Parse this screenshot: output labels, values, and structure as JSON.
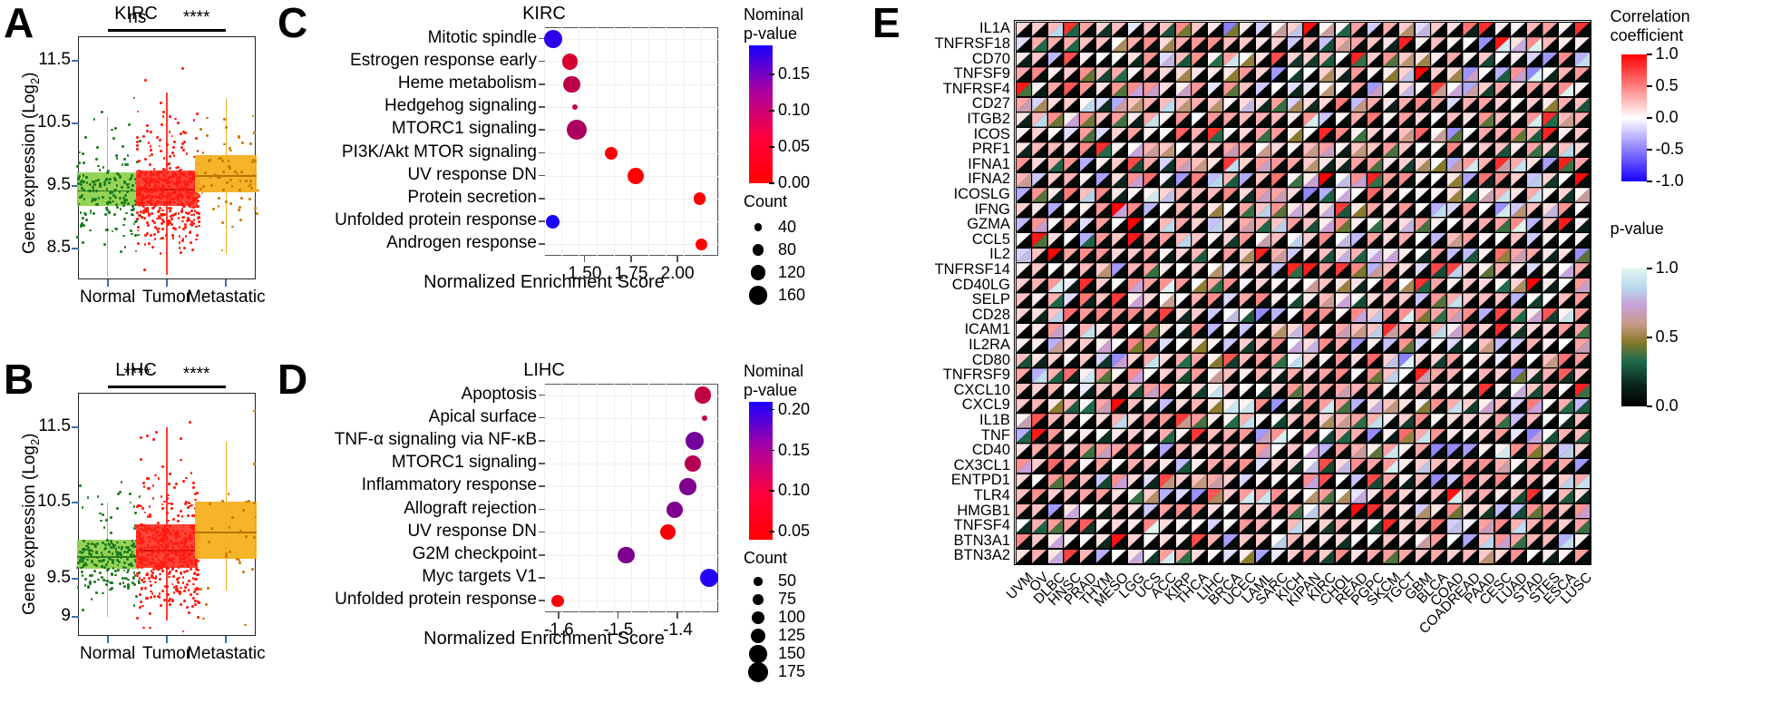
{
  "figure": {
    "panels": [
      "A",
      "B",
      "C",
      "D",
      "E"
    ]
  },
  "panelA": {
    "letter": "A",
    "title": "KIRC",
    "ylabel_pre": "Gene expression (Log",
    "ylabel_sub": "2",
    "ylabel_post": ")",
    "yticks": [
      "11.5",
      "10.5",
      "9.5",
      "8.5"
    ],
    "xticks": [
      "Normal",
      "Tumor",
      "Metastatic"
    ],
    "significance": [
      "ns",
      "****"
    ],
    "colors": {
      "normal": "#8fd14f",
      "normal_dark": "#1d7a1d",
      "tumor": "#ff3b30",
      "tumor_dark": "#e01b10",
      "metastatic": "#f5b01e",
      "metastatic_dark": "#cc7a00"
    }
  },
  "panelB": {
    "letter": "B",
    "title": "LIHC",
    "ylabel_pre": "Gene expression (Log",
    "ylabel_sub": "2",
    "ylabel_post": ")",
    "yticks": [
      "11.5",
      "10.5",
      "9.5",
      "9"
    ],
    "xticks": [
      "Normal",
      "Tumor",
      "Metastatic"
    ],
    "significance": [
      "****",
      "****"
    ]
  },
  "panelC": {
    "letter": "C",
    "title": "KIRC",
    "xlabel": "Normalized Enrichment Score",
    "xticks": [
      "1.50",
      "1.75",
      "2.00"
    ],
    "legend_color_title_line1": "Nominal",
    "legend_color_title_line2": "p-value",
    "legend_color_ticks": [
      "0.15",
      "0.10",
      "0.05",
      "0.00"
    ],
    "legend_size_title": "Count",
    "legend_size_values": [
      "40",
      "80",
      "120",
      "160"
    ],
    "pathways": [
      {
        "label": "Mitotic spindle",
        "nes": 1.33,
        "pvalue": 0.175,
        "count": 150
      },
      {
        "label": "Estrogen response early",
        "nes": 1.42,
        "pvalue": 0.035,
        "count": 130
      },
      {
        "label": "Heme metabolism",
        "nes": 1.43,
        "pvalue": 0.055,
        "count": 140
      },
      {
        "label": "Hedgehog signaling",
        "nes": 1.445,
        "pvalue": 0.045,
        "count": 20
      },
      {
        "label": "MTORC1 signaling",
        "nes": 1.455,
        "pvalue": 0.07,
        "count": 170
      },
      {
        "label": "PI3K/Akt MTOR signaling",
        "nes": 1.64,
        "pvalue": 0.005,
        "count": 95
      },
      {
        "label": "UV response DN",
        "nes": 1.775,
        "pvalue": 0.0,
        "count": 130
      },
      {
        "label": "Protein secretion",
        "nes": 2.12,
        "pvalue": 0.0,
        "count": 90
      },
      {
        "label": "Unfolded protein response",
        "nes": 1.325,
        "pvalue": 0.19,
        "count": 105
      },
      {
        "label": "Androgen response",
        "nes": 2.13,
        "pvalue": 0.0,
        "count": 90
      }
    ]
  },
  "panelD": {
    "letter": "D",
    "title": "LIHC",
    "xlabel": "Normalized Enrichment Score",
    "xticks": [
      "-1.6",
      "-1.5",
      "-1.4"
    ],
    "legend_color_title_line1": "Nominal",
    "legend_color_title_line2": "p-value",
    "legend_color_ticks": [
      "0.20",
      "0.15",
      "0.10",
      "0.05"
    ],
    "legend_size_title": "Count",
    "legend_size_values": [
      "50",
      "75",
      "100",
      "125",
      "150",
      "175"
    ],
    "pathways": [
      {
        "label": "Apoptosis",
        "nes": -1.358,
        "pvalue": 0.085,
        "count": 140
      },
      {
        "label": "Apical surface",
        "nes": -1.355,
        "pvalue": 0.09,
        "count": 20
      },
      {
        "label": "TNF-α signaling via NF-κB",
        "nes": -1.372,
        "pvalue": 0.145,
        "count": 155
      },
      {
        "label": "MTORC1 signaling",
        "nes": -1.375,
        "pvalue": 0.095,
        "count": 140
      },
      {
        "label": "Inflammatory response",
        "nes": -1.383,
        "pvalue": 0.135,
        "count": 140
      },
      {
        "label": "Allograft rejection",
        "nes": -1.405,
        "pvalue": 0.135,
        "count": 135
      },
      {
        "label": "UV response DN",
        "nes": -1.417,
        "pvalue": 0.045,
        "count": 130
      },
      {
        "label": "G2M checkpoint",
        "nes": -1.487,
        "pvalue": 0.135,
        "count": 140
      },
      {
        "label": "Myc targets V1",
        "nes": -1.347,
        "pvalue": 0.205,
        "count": 160
      },
      {
        "label": "Unfolded protein response",
        "nes": -1.602,
        "pvalue": 0.045,
        "count": 90
      }
    ]
  },
  "panelE": {
    "letter": "E",
    "legend_corr_title_line1": "Correlation",
    "legend_corr_title_line2": "coefficient",
    "legend_corr_ticks": [
      "1.0",
      "0.5",
      "0.0",
      "-0.5",
      "-1.0"
    ],
    "legend_p_title": "p-value",
    "legend_p_ticks": [
      "1.0",
      "0.5",
      "0.0"
    ],
    "genes": [
      "IL1A",
      "TNFRSF18",
      "CD70",
      "TNFSF9",
      "TNFRSF4",
      "CD27",
      "ITGB2",
      "ICOS",
      "PRF1",
      "IFNA1",
      "IFNA2",
      "ICOSLG",
      "IFNG",
      "GZMA",
      "CCL5",
      "IL2",
      "TNFRSF14",
      "CD40LG",
      "SELP",
      "CD28",
      "ICAM1",
      "IL2RA",
      "CD80",
      "TNFRSF9",
      "CXCL10",
      "CXCL9",
      "IL1B",
      "TNF",
      "CD40",
      "CX3CL1",
      "ENTPD1",
      "TLR4",
      "HMGB1",
      "TNFSF4",
      "BTN3A1",
      "BTN3A2"
    ],
    "cancers": [
      "UVM",
      "OV",
      "DLBC",
      "HNSC",
      "PRAD",
      "THYM",
      "MESO",
      "LGG",
      "UCS",
      "ACC",
      "KIRP",
      "THCA",
      "LIHC",
      "BRCA",
      "UCEC",
      "LAML",
      "SARC",
      "KICH",
      "KIPAN",
      "KIRC",
      "CHOL",
      "READ",
      "PGPC",
      "SKCM",
      "TGCT",
      "GBM",
      "BLCA",
      "COAD",
      "COADREAD",
      "PAAD",
      "CESC",
      "LUAD",
      "STAD",
      "STES",
      "ESCA",
      "LUSC"
    ]
  },
  "chart_data": [
    {
      "type": "box",
      "title": "KIRC",
      "xlabel": "",
      "ylabel": "Gene expression (Log2)",
      "categories": [
        "Normal",
        "Tumor",
        "Metastatic"
      ],
      "ylim": [
        8.0,
        11.9
      ],
      "yticks": [
        11.5,
        10.5,
        9.5,
        8.5
      ],
      "boxes": [
        {
          "name": "Normal",
          "q1": 9.18,
          "median": 9.43,
          "q3": 9.72,
          "whisker_low": 8.05,
          "whisker_high": 10.6,
          "color": "#8fd14f",
          "n": 190
        },
        {
          "name": "Tumor",
          "q1": 9.18,
          "median": 9.45,
          "q3": 9.75,
          "whisker_low": 8.08,
          "whisker_high": 11.0,
          "color": "#ff3b30",
          "n": 520
        },
        {
          "name": "Metastatic",
          "q1": 9.4,
          "median": 9.67,
          "q3": 10.0,
          "whisker_low": 8.4,
          "whisker_high": 10.9,
          "color": "#f5b01e",
          "n": 70
        }
      ],
      "annotations": [
        {
          "text": "ns",
          "between": [
            "Normal",
            "Tumor"
          ]
        },
        {
          "text": "****",
          "between": [
            "Tumor",
            "Metastatic"
          ]
        }
      ],
      "grid": false
    },
    {
      "type": "box",
      "title": "LIHC",
      "xlabel": "",
      "ylabel": "Gene expression (Log2)",
      "categories": [
        "Normal",
        "Tumor",
        "Metastatic"
      ],
      "ylim": [
        8.75,
        11.95
      ],
      "yticks": [
        11.5,
        10.5,
        9.5,
        9.0
      ],
      "boxes": [
        {
          "name": "Normal",
          "q1": 9.63,
          "median": 9.8,
          "q3": 10.02,
          "whisker_low": 9.0,
          "whisker_high": 10.5,
          "color": "#8fd14f",
          "n": 220
        },
        {
          "name": "Tumor",
          "q1": 9.65,
          "median": 9.88,
          "q3": 10.22,
          "whisker_low": 8.95,
          "whisker_high": 11.5,
          "color": "#ff3b30",
          "n": 520
        },
        {
          "name": "Metastatic",
          "q1": 9.76,
          "median": 10.12,
          "q3": 10.52,
          "whisker_low": 9.35,
          "whisker_high": 11.3,
          "color": "#f5b01e",
          "n": 30
        }
      ],
      "annotations": [
        {
          "text": "****",
          "between": [
            "Normal",
            "Tumor"
          ]
        },
        {
          "text": "****",
          "between": [
            "Tumor",
            "Metastatic"
          ]
        }
      ],
      "grid": false
    },
    {
      "type": "scatter",
      "title": "KIRC",
      "xlabel": "Normalized Enrichment Score",
      "ylabel": "",
      "xlim": [
        1.28,
        2.22
      ],
      "xticks": [
        1.5,
        1.75,
        2.0
      ],
      "legend_color": {
        "title": "Nominal p-value",
        "ticks": [
          0.15,
          0.1,
          0.05,
          0.0
        ],
        "low_color": "#ff0000",
        "high_color": "#1a00ff"
      },
      "legend_size": {
        "title": "Count",
        "values": [
          40,
          80,
          120,
          160
        ]
      },
      "points": [
        {
          "y": "Mitotic spindle",
          "x": 1.33,
          "p": 0.175,
          "count": 150
        },
        {
          "y": "Estrogen response early",
          "x": 1.42,
          "p": 0.035,
          "count": 130
        },
        {
          "y": "Heme metabolism",
          "x": 1.43,
          "p": 0.055,
          "count": 140
        },
        {
          "y": "Hedgehog signaling",
          "x": 1.445,
          "p": 0.045,
          "count": 20
        },
        {
          "y": "MTORC1 signaling",
          "x": 1.455,
          "p": 0.07,
          "count": 170
        },
        {
          "y": "PI3K/Akt MTOR signaling",
          "x": 1.64,
          "p": 0.005,
          "count": 95
        },
        {
          "y": "UV response DN",
          "x": 1.775,
          "p": 0.0,
          "count": 130
        },
        {
          "y": "Protein secretion",
          "x": 2.12,
          "p": 0.0,
          "count": 90
        },
        {
          "y": "Unfolded protein response",
          "x": 1.325,
          "p": 0.19,
          "count": 105
        },
        {
          "y": "Androgen response",
          "x": 2.13,
          "p": 0.0,
          "count": 90
        }
      ]
    },
    {
      "type": "scatter",
      "title": "LIHC",
      "xlabel": "Normalized Enrichment Score",
      "ylabel": "",
      "xlim": [
        -1.625,
        -1.332
      ],
      "xticks": [
        -1.6,
        -1.5,
        -1.4
      ],
      "legend_color": {
        "title": "Nominal p-value",
        "ticks": [
          0.2,
          0.15,
          0.1,
          0.05
        ],
        "low_color": "#ff0000",
        "high_color": "#1a00ff"
      },
      "legend_size": {
        "title": "Count",
        "values": [
          50,
          75,
          100,
          125,
          150,
          175
        ]
      },
      "points": [
        {
          "y": "Apoptosis",
          "x": -1.358,
          "p": 0.085,
          "count": 140
        },
        {
          "y": "Apical surface",
          "x": -1.355,
          "p": 0.09,
          "count": 20
        },
        {
          "y": "TNF-α signaling via NF-κB",
          "x": -1.372,
          "p": 0.145,
          "count": 155
        },
        {
          "y": "MTORC1 signaling",
          "x": -1.375,
          "p": 0.095,
          "count": 140
        },
        {
          "y": "Inflammatory response",
          "x": -1.383,
          "p": 0.135,
          "count": 140
        },
        {
          "y": "Allograft rejection",
          "x": -1.405,
          "p": 0.135,
          "count": 135
        },
        {
          "y": "UV response DN",
          "x": -1.417,
          "p": 0.045,
          "count": 130
        },
        {
          "y": "G2M checkpoint",
          "x": -1.487,
          "p": 0.135,
          "count": 140
        },
        {
          "y": "Myc targets V1",
          "x": -1.347,
          "p": 0.205,
          "count": 160
        },
        {
          "y": "Unfolded protein response",
          "x": -1.602,
          "p": 0.045,
          "count": 90
        }
      ]
    },
    {
      "type": "heatmap",
      "title": "",
      "xlabel": "",
      "ylabel": "",
      "rows": [
        "IL1A",
        "TNFRSF18",
        "CD70",
        "TNFSF9",
        "TNFRSF4",
        "CD27",
        "ITGB2",
        "ICOS",
        "PRF1",
        "IFNA1",
        "IFNA2",
        "ICOSLG",
        "IFNG",
        "GZMA",
        "CCL5",
        "IL2",
        "TNFRSF14",
        "CD40LG",
        "SELP",
        "CD28",
        "ICAM1",
        "IL2RA",
        "CD80",
        "TNFRSF9",
        "CXCL10",
        "CXCL9",
        "IL1B",
        "TNF",
        "CD40",
        "CX3CL1",
        "ENTPD1",
        "TLR4",
        "HMGB1",
        "TNFSF4",
        "BTN3A1",
        "BTN3A2"
      ],
      "columns": [
        "UVM",
        "OV",
        "DLBC",
        "HNSC",
        "PRAD",
        "THYM",
        "MESO",
        "LGG",
        "UCS",
        "ACC",
        "KIRP",
        "THCA",
        "LIHC",
        "BRCA",
        "UCEC",
        "LAML",
        "SARC",
        "KICH",
        "KIPAN",
        "KIRC",
        "CHOL",
        "READ",
        "PGPC",
        "SKCM",
        "TGCT",
        "GBM",
        "BLCA",
        "COAD",
        "COADREAD",
        "PAAD",
        "CESC",
        "LUAD",
        "STAD",
        "STES",
        "ESCA",
        "LUSC"
      ],
      "cell_split": "diagonal",
      "upper_metric": "Correlation coefficient",
      "lower_metric": "p-value",
      "upper_scale": {
        "min": -1.0,
        "max": 1.0,
        "colors": [
          "#1a00ff",
          "#ffffff",
          "#ff0000"
        ]
      },
      "lower_scale": {
        "min": 0.0,
        "max": 1.0,
        "colors": [
          "#000000",
          "#1f6b4a",
          "#8a7a2a",
          "#c89b8a",
          "#c8a0d8",
          "#b9d8ec",
          "#dff5f0"
        ]
      }
    }
  ]
}
